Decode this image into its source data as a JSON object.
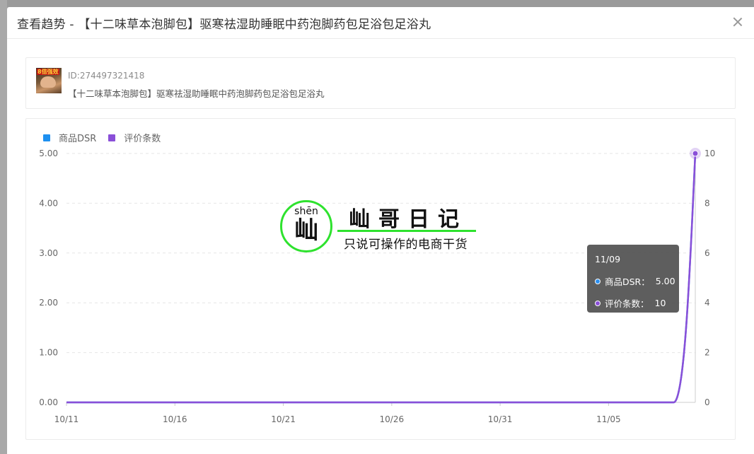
{
  "modal": {
    "title": "查看趋势 - 【十二味草本泡脚包】驱寒祛湿助睡眠中药泡脚药包足浴包足浴丸"
  },
  "product": {
    "id_text": "ID:274497321418",
    "name": "【十二味草本泡脚包】驱寒祛湿助睡眠中药泡脚药包足浴包足浴丸",
    "thumb_badge": "8倍强效"
  },
  "watermark": {
    "pinyin": "shēn",
    "char": "屾",
    "title": "屾哥日记",
    "subtitle": "只说可操作的电商干货"
  },
  "tooltip": {
    "date": "11/09",
    "rows": [
      {
        "label": "商品DSR：",
        "value": "5.00",
        "color": "#2b8ff0"
      },
      {
        "label": "评价条数：",
        "value": "10",
        "color": "#8a4fd8"
      }
    ]
  },
  "colors": {
    "dsr": "#1e90f0",
    "reviews": "#8a4fd8"
  },
  "chart_data": {
    "type": "line",
    "x": [
      "10/11",
      "10/12",
      "10/13",
      "10/14",
      "10/15",
      "10/16",
      "10/17",
      "10/18",
      "10/19",
      "10/20",
      "10/21",
      "10/22",
      "10/23",
      "10/24",
      "10/25",
      "10/26",
      "10/27",
      "10/28",
      "10/29",
      "10/30",
      "10/31",
      "11/01",
      "11/02",
      "11/03",
      "11/04",
      "11/05",
      "11/06",
      "11/07",
      "11/08",
      "11/09"
    ],
    "x_tick_labels": [
      "10/11",
      "10/16",
      "10/21",
      "10/26",
      "10/31",
      "11/05"
    ],
    "series": [
      {
        "name": "商品DSR",
        "axis": "left",
        "values": [
          0,
          0,
          0,
          0,
          0,
          0,
          0,
          0,
          0,
          0,
          0,
          0,
          0,
          0,
          0,
          0,
          0,
          0,
          0,
          0,
          0,
          0,
          0,
          0,
          0,
          0,
          0,
          0,
          0,
          5.0
        ]
      },
      {
        "name": "评价条数",
        "axis": "right",
        "values": [
          0,
          0,
          0,
          0,
          0,
          0,
          0,
          0,
          0,
          0,
          0,
          0,
          0,
          0,
          0,
          0,
          0,
          0,
          0,
          0,
          0,
          0,
          0,
          0,
          0,
          0,
          0,
          0,
          0,
          10
        ]
      }
    ],
    "y_left_ticks": [
      "0.00",
      "1.00",
      "2.00",
      "3.00",
      "4.00",
      "5.00"
    ],
    "y_left_lim": [
      0,
      5
    ],
    "y_right_ticks": [
      "0",
      "2",
      "4",
      "6",
      "8",
      "10"
    ],
    "y_right_lim": [
      0,
      10
    ],
    "grid": true,
    "legend": "top-left"
  }
}
